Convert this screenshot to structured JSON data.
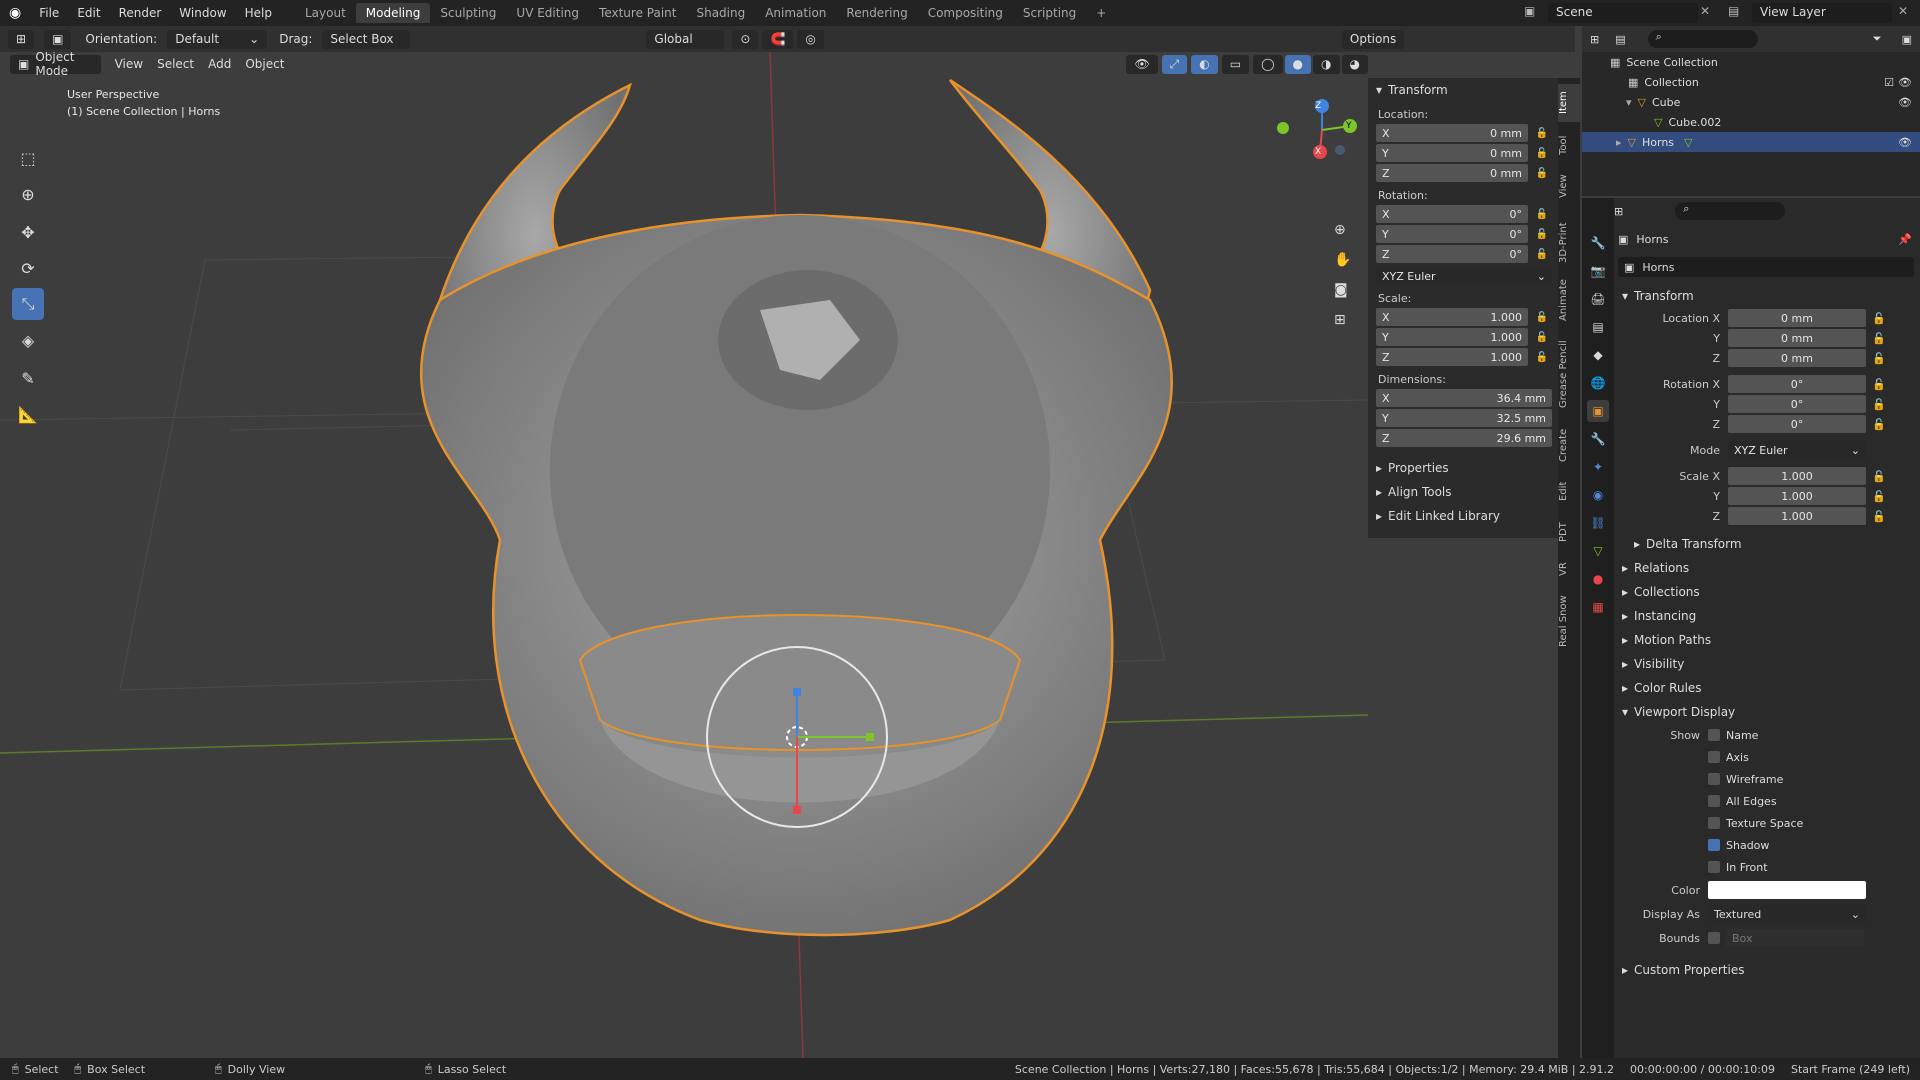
{
  "topbar": {
    "menus": [
      "File",
      "Edit",
      "Render",
      "Window",
      "Help"
    ],
    "workspaces": [
      "Layout",
      "Modeling",
      "Sculpting",
      "UV Editing",
      "Texture Paint",
      "Shading",
      "Animation",
      "Rendering",
      "Compositing",
      "Scripting"
    ],
    "active_workspace": "Modeling",
    "add_tab": "+",
    "scene": "Scene",
    "view_layer": "View Layer"
  },
  "header": {
    "orientation_label": "Orientation:",
    "orientation_value": "Default",
    "drag_label": "Drag:",
    "drag_value": "Select Box",
    "transform_orientation": "Global",
    "options": "Options"
  },
  "viewport_header": {
    "mode": "Object Mode",
    "menus": [
      "View",
      "Select",
      "Add",
      "Object"
    ]
  },
  "viewport": {
    "overlay_line1": "User Perspective",
    "overlay_line2": "(1) Scene Collection | Horns",
    "gizmo_axes": [
      "Z",
      "Y",
      "X"
    ]
  },
  "npanel": {
    "title": "Transform",
    "location_label": "Location:",
    "location": [
      {
        "axis": "X",
        "value": "0 mm"
      },
      {
        "axis": "Y",
        "value": "0 mm"
      },
      {
        "axis": "Z",
        "value": "0 mm"
      }
    ],
    "rotation_label": "Rotation:",
    "rotation": [
      {
        "axis": "X",
        "value": "0°"
      },
      {
        "axis": "Y",
        "value": "0°"
      },
      {
        "axis": "Z",
        "value": "0°"
      }
    ],
    "rotation_mode": "XYZ Euler",
    "scale_label": "Scale:",
    "scale": [
      {
        "axis": "X",
        "value": "1.000"
      },
      {
        "axis": "Y",
        "value": "1.000"
      },
      {
        "axis": "Z",
        "value": "1.000"
      }
    ],
    "dimensions_label": "Dimensions:",
    "dimensions": [
      {
        "axis": "X",
        "value": "36.4 mm"
      },
      {
        "axis": "Y",
        "value": "32.5 mm"
      },
      {
        "axis": "Z",
        "value": "29.6 mm"
      }
    ],
    "collapsed": [
      "Properties",
      "Align Tools",
      "Edit Linked Library"
    ]
  },
  "vtabs": [
    "Item",
    "Tool",
    "View",
    "3D-Print",
    "Animate",
    "Grease Pencil",
    "Create",
    "Edit",
    "PDT",
    "VR",
    "Real Snow"
  ],
  "outliner": {
    "root": "Scene Collection",
    "items": [
      {
        "name": "Collection",
        "indent": 1
      },
      {
        "name": "Cube",
        "indent": 2
      },
      {
        "name": "Cube.002",
        "indent": 3
      },
      {
        "name": "Horns",
        "indent": 2
      }
    ]
  },
  "properties": {
    "object_name": "Horns",
    "object_name_field": "Horns",
    "transform_title": "Transform",
    "location": [
      {
        "label": "Location X",
        "value": "0 mm"
      },
      {
        "label": "Y",
        "value": "0 mm"
      },
      {
        "label": "Z",
        "value": "0 mm"
      }
    ],
    "rotation": [
      {
        "label": "Rotation X",
        "value": "0°"
      },
      {
        "label": "Y",
        "value": "0°"
      },
      {
        "label": "Z",
        "value": "0°"
      }
    ],
    "mode_label": "Mode",
    "mode_value": "XYZ Euler",
    "scale": [
      {
        "label": "Scale X",
        "value": "1.000"
      },
      {
        "label": "Y",
        "value": "1.000"
      },
      {
        "label": "Z",
        "value": "1.000"
      }
    ],
    "delta_transform": "Delta Transform",
    "sections": [
      "Relations",
      "Collections",
      "Instancing",
      "Motion Paths",
      "Visibility",
      "Color Rules"
    ],
    "viewport_display": "Viewport Display",
    "show_label": "Show",
    "show_items": [
      {
        "label": "Name",
        "checked": false
      },
      {
        "label": "Axis",
        "checked": false
      },
      {
        "label": "Wireframe",
        "checked": false
      },
      {
        "label": "All Edges",
        "checked": false
      },
      {
        "label": "Texture Space",
        "checked": false
      },
      {
        "label": "Shadow",
        "checked": true
      },
      {
        "label": "In Front",
        "checked": false
      }
    ],
    "color_label": "Color",
    "display_as_label": "Display As",
    "display_as_value": "Textured",
    "bounds_label": "Bounds",
    "bounds_value": "Box",
    "custom_properties": "Custom Properties"
  },
  "statusbar": {
    "select": "Select",
    "box_select": "Box Select",
    "dolly_view": "Dolly View",
    "lasso_select": "Lasso Select",
    "stats": "Scene Collection | Horns | Verts:27,180 | Faces:55,678 | Tris:55,684 | Objects:1/2 | Memory: 29.4 MiB | 2.91.2",
    "time": "00:00:00:00 / 00:00:10:09",
    "frame": "Start Frame (249 left)"
  },
  "colors": {
    "selection_outline": "#e8922b",
    "active_tool": "#4772b3",
    "axis_x": "#e8464a",
    "axis_y": "#7ec528",
    "axis_z": "#3f84e0"
  }
}
